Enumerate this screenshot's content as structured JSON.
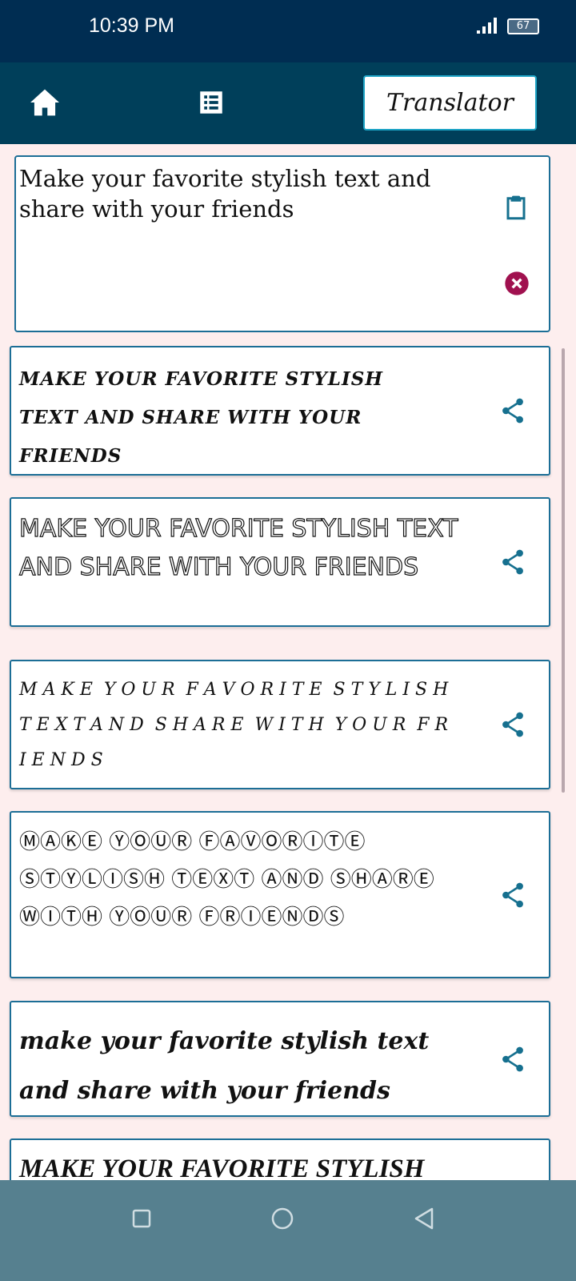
{
  "status_bar": {
    "time": "10:39 PM",
    "battery": "67"
  },
  "app_bar": {
    "home_icon": "home-icon",
    "list_icon": "list-icon",
    "translator_label": "Translator"
  },
  "input": {
    "value": "Make your favorite stylish text and share with your friends",
    "clipboard_icon": "clipboard-icon",
    "clear_icon": "clear-icon"
  },
  "cards": [
    {
      "text": "MAKE YOUR FAVORITE STYLISH TEXT AND SHARE WITH YOUR FRIENDS"
    },
    {
      "text": "MAKE YOUR FAVORITE STYLISH TEXT AND SHARE WITH YOUR FRIENDS"
    },
    {
      "text": "M A K E  Y O U R  F A V O R I T E  S T Y L I S H  T E X T A N D  S H A R E  W I T H  Y O U R  F R I E N D S"
    },
    {
      "text": "ⓂⒶⓀⒺ ⓎⓄⓊⓇ ⒻⒶⓋⓄⓇⒾⓉⒺ ⓈⓉⓎⓁⒾⓈⒽ ⓉⒺⓍⓉ ⒶⓃⒹ ⓈⒽⒶⓇⒺ ⓌⒾⓉⒽ ⓎⓄⓊⓇ ⒻⓇⒾⒺⓃⒹⓈ"
    },
    {
      "text": "make your favorite stylish text and share with your friends"
    },
    {
      "text": "MAKE YOUR FAVORITE STYLISH"
    }
  ],
  "colors": {
    "status_bar": "#002d52",
    "app_bar": "#003f5a",
    "accent": "#1c6e96",
    "share": "#16708f",
    "clear": "#a0114f",
    "background": "#fdeeee",
    "nav_bar": "#56808f"
  }
}
